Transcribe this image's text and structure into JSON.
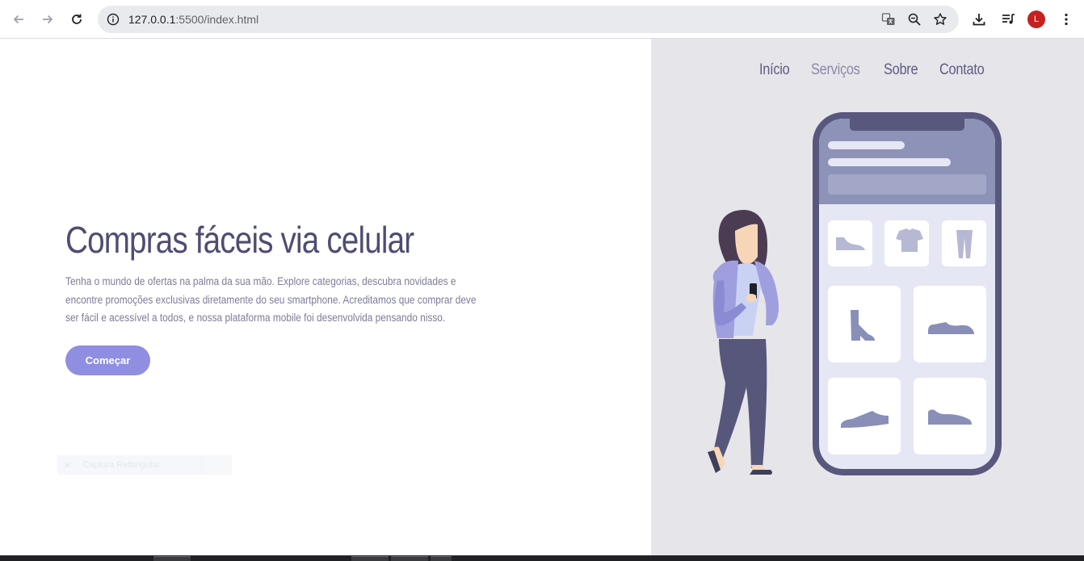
{
  "browser": {
    "url_host": "127.0.0.1",
    "url_rest": ":5500/index.html",
    "avatar_letter": "L"
  },
  "nav": {
    "items": [
      {
        "label": "Início"
      },
      {
        "label": "Serviços"
      },
      {
        "label": "Sobre"
      },
      {
        "label": "Contato"
      }
    ]
  },
  "hero": {
    "title": "Compras fáceis via celular",
    "description": "Tenha o mundo de ofertas na palma da sua mão. Explore categorias, descubra novidades e encontre promoções exclusivas diretamente do seu smartphone. Acreditamos que comprar deve ser fácil e acessível a todos, e nossa plataforma mobile foi desenvolvida pensando nisso.",
    "button_label": "Começar"
  },
  "overlay": {
    "faded_label": "Captura Retangular"
  },
  "colors": {
    "accent": "#8f8ee0",
    "title": "#4f4d72",
    "panel_bg": "#e6e5ea",
    "phone_frame": "#58577e"
  },
  "icons": [
    "back-arrow-icon",
    "forward-arrow-icon",
    "reload-icon",
    "info-icon",
    "translate-icon",
    "zoom-icon",
    "star-icon",
    "download-icon",
    "media-icon",
    "menu-icon"
  ]
}
